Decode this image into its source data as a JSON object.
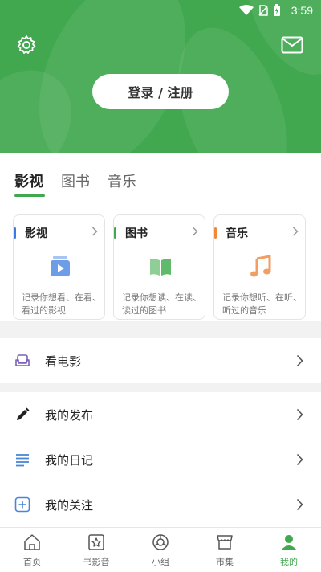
{
  "status": {
    "time": "3:59"
  },
  "header": {
    "login_label": "登录 / 注册"
  },
  "tabs": [
    {
      "label": "影视"
    },
    {
      "label": "图书"
    },
    {
      "label": "音乐"
    }
  ],
  "cards": [
    {
      "title": "影视",
      "desc": "记录你想看、在看、看过的影视",
      "accent": "#3d7ae0"
    },
    {
      "title": "图书",
      "desc": "记录你想读、在读、读过的图书",
      "accent": "#41a84f"
    },
    {
      "title": "音乐",
      "desc": "记录你想听、在听、听过的音乐",
      "accent": "#f0883c"
    }
  ],
  "list": {
    "movie": "看电影",
    "posts": "我的发布",
    "diary": "我的日记",
    "follow": "我的关注"
  },
  "nav": [
    {
      "label": "首页"
    },
    {
      "label": "书影音"
    },
    {
      "label": "小组"
    },
    {
      "label": "市集"
    },
    {
      "label": "我的"
    }
  ],
  "colors": {
    "brand": "#41a84f",
    "background": "#f2f2f2"
  }
}
